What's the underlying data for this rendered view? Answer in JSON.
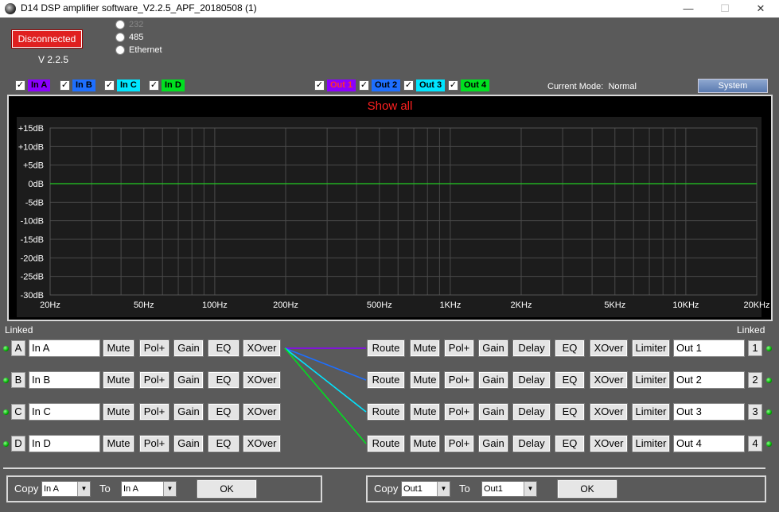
{
  "window": {
    "title": "D14 DSP amplifier software_V2.2.5_APF_20180508 (1)",
    "minimize": "—",
    "maximize": "☐",
    "close": "✕"
  },
  "status": {
    "connection": "Disconnected",
    "version": "V 2.2.5"
  },
  "connection_options": [
    {
      "label": "232",
      "selected": false
    },
    {
      "label": "485",
      "selected": false
    },
    {
      "label": "Ethernet",
      "selected": false
    }
  ],
  "input_toggles": [
    {
      "label": "In A",
      "checked": true,
      "color": "#8b00ff",
      "text_color": "#000000"
    },
    {
      "label": "In B",
      "checked": true,
      "color": "#1e6fff",
      "text_color": "#000000"
    },
    {
      "label": "In C",
      "checked": true,
      "color": "#00e5ff",
      "text_color": "#000000"
    },
    {
      "label": "In D",
      "checked": true,
      "color": "#00e020",
      "text_color": "#000000"
    }
  ],
  "output_toggles": [
    {
      "label": "Out 1",
      "checked": true,
      "color": "#8b00ff",
      "text_color": "#ff3030"
    },
    {
      "label": "Out 2",
      "checked": true,
      "color": "#1e6fff",
      "text_color": "#000000"
    },
    {
      "label": "Out 3",
      "checked": true,
      "color": "#00e5ff",
      "text_color": "#000000"
    },
    {
      "label": "Out 4",
      "checked": true,
      "color": "#00e020",
      "text_color": "#000000"
    }
  ],
  "mode": {
    "label": "Current Mode:",
    "value": "Normal"
  },
  "system_button": "System",
  "graph": {
    "title": "Show all",
    "y_ticks": [
      "+15dB",
      "+10dB",
      "+5dB",
      "0dB",
      "-5dB",
      "-10dB",
      "-15dB",
      "-20dB",
      "-25dB",
      "-30dB"
    ],
    "x_ticks": [
      "20Hz",
      "50Hz",
      "100Hz",
      "200Hz",
      "500Hz",
      "1KHz",
      "2KHz",
      "5KHz",
      "10KHz",
      "20KHz"
    ],
    "response_color": "#22cc22"
  },
  "chart_data": {
    "type": "line",
    "title": "Show all",
    "xlabel": "",
    "ylabel": "",
    "x_scale": "log",
    "xlim": [
      20,
      20000
    ],
    "ylim": [
      -30,
      15
    ],
    "grid": true,
    "series": [
      {
        "x": [
          20,
          20000
        ],
        "y": [
          0,
          0
        ],
        "color": "#22cc22"
      }
    ]
  },
  "linked_left": "Linked",
  "linked_right": "Linked",
  "inputs": [
    {
      "channel": "A",
      "name": "In A"
    },
    {
      "channel": "B",
      "name": "In B"
    },
    {
      "channel": "C",
      "name": "In C"
    },
    {
      "channel": "D",
      "name": "In D"
    }
  ],
  "outputs": [
    {
      "channel": "1",
      "name": "Out 1"
    },
    {
      "channel": "2",
      "name": "Out 2"
    },
    {
      "channel": "3",
      "name": "Out 3"
    },
    {
      "channel": "4",
      "name": "Out 4"
    }
  ],
  "input_buttons": [
    "Mute",
    "Pol+",
    "Gain",
    "EQ",
    "XOver"
  ],
  "output_buttons": [
    "Route",
    "Mute",
    "Pol+",
    "Gain",
    "Delay",
    "EQ",
    "XOver",
    "Limiter"
  ],
  "routing_colors": [
    "#8b00ff",
    "#1e6fff",
    "#00e5ff",
    "#00e020"
  ],
  "copy_inputs": {
    "copy_label": "Copy",
    "from": "In A",
    "to_label": "To",
    "to": "In A",
    "ok": "OK"
  },
  "copy_outputs": {
    "copy_label": "Copy",
    "from": "Out1",
    "to_label": "To",
    "to": "Out1",
    "ok": "OK"
  }
}
